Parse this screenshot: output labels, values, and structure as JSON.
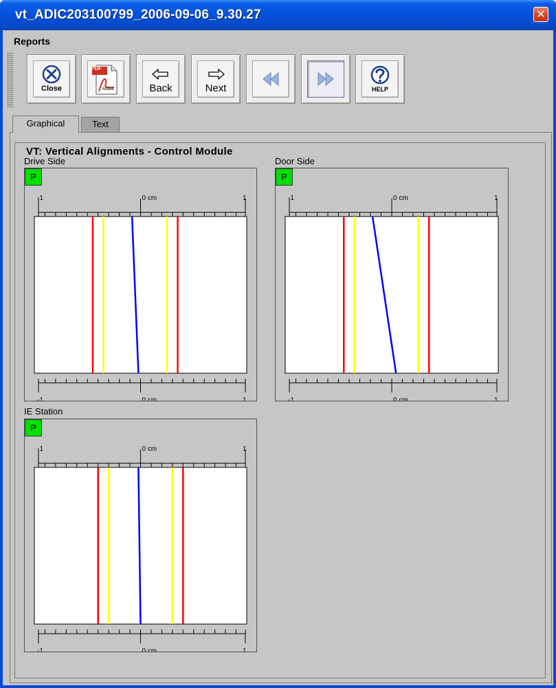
{
  "window": {
    "title": "vt_ADIC203100799_2006-09-06_9.30.27",
    "close_glyph": "✕"
  },
  "menu": {
    "reports_label": "Reports"
  },
  "toolbar": {
    "close_label": "Close",
    "pdf_label": "PDF",
    "pdf_sub_label": "Adobe",
    "back_label": "Back",
    "next_label": "Next",
    "help_label": "HELP",
    "rewind_icon": "rewind-icon",
    "fastforward_icon": "fast-forward-icon"
  },
  "tabs": [
    {
      "label": "Graphical",
      "active": true
    },
    {
      "label": "Text",
      "active": false
    }
  ],
  "group": {
    "title": "VT: Vertical Alignments - Control Module"
  },
  "colors": {
    "limit_outer": "#ff0000",
    "limit_inner": "#ffff00",
    "trace": "#0000ff",
    "status_pass": "#00e000"
  },
  "chart_data": [
    {
      "type": "line",
      "title": "Drive Side",
      "status": "P",
      "xlim": [
        -1,
        1
      ],
      "tick_left": "-1",
      "tick_center": "0 cm",
      "tick_right": "1",
      "red_limits": [
        -0.45,
        0.35
      ],
      "yellow_limits": [
        -0.35,
        0.25
      ],
      "trace": {
        "top": -0.08,
        "bottom": -0.02
      }
    },
    {
      "type": "line",
      "title": "Door Side",
      "status": "P",
      "xlim": [
        -1,
        1
      ],
      "tick_left": "-1",
      "tick_center": "0 cm",
      "tick_right": "1",
      "red_limits": [
        -0.45,
        0.35
      ],
      "yellow_limits": [
        -0.35,
        0.25
      ],
      "trace": {
        "top": -0.18,
        "bottom": 0.04
      }
    },
    {
      "type": "line",
      "title": "IE Station",
      "status": "P",
      "xlim": [
        -1,
        1
      ],
      "tick_left": "-1",
      "tick_center": "0 cm",
      "tick_right": "1",
      "red_limits": [
        -0.4,
        0.4
      ],
      "yellow_limits": [
        -0.3,
        0.3
      ],
      "trace": {
        "top": -0.02,
        "bottom": 0.0
      }
    }
  ]
}
